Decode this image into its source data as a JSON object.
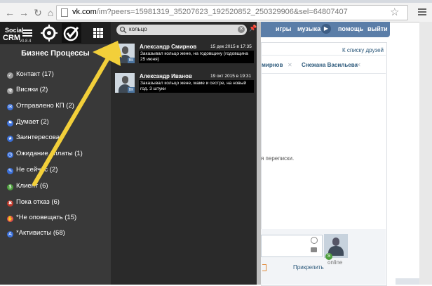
{
  "browser": {
    "url_host": "vk.com",
    "url_rest": "/im?peers=15981319_35207623_192520852_250329906&sel=64807407"
  },
  "vk": {
    "nav": [
      "игры",
      "музыка",
      "помощь",
      "выйти"
    ],
    "to_friends": "К списку друзей",
    "friends": [
      "мирнов",
      "Снежана Васильева"
    ],
    "history_text": "я переписки.",
    "attach": "Прикрепить",
    "online": "online",
    "s_badge": "S"
  },
  "sidebar": {
    "logo_line1": "Social",
    "logo_line2": "CRM",
    "version": "v0.8.4",
    "heading": "Бизнес Процессы",
    "items": [
      {
        "label": "Контакт (17)",
        "color": "#9a9a9a",
        "glyph": "✓"
      },
      {
        "label": "Висяки (2)",
        "color": "#9a9a9a",
        "glyph": "✻"
      },
      {
        "label": "Отправлено КП (2)",
        "color": "#3a6fd8",
        "glyph": "✉"
      },
      {
        "label": "Думает (2)",
        "color": "#3a6fd8",
        "glyph": "⚑"
      },
      {
        "label": "Заинтересован",
        "color": "#3a6fd8",
        "glyph": "★"
      },
      {
        "label": "Ожидание оплаты (1)",
        "color": "#3a6fd8",
        "glyph": "◷"
      },
      {
        "label": "Не сейчас (2)",
        "color": "#3a6fd8",
        "glyph": "✎"
      },
      {
        "label": "Клиент (6)",
        "color": "#4e9f3d",
        "glyph": "$"
      },
      {
        "label": "Пока отказ (6)",
        "color": "#c0392b",
        "glyph": "✖"
      },
      {
        "label": "*Не оповещать (15)",
        "color": "#e05050",
        "glyph": "✋"
      },
      {
        "label": "*Активисты (68)",
        "color": "#3a6fd8",
        "glyph": "A"
      }
    ]
  },
  "search": {
    "query": "кольцо",
    "results": [
      {
        "name": "Александр Смирнов",
        "date": "15 дек 2015 в 17:35",
        "text": "Заказывал кольцо жене, на годовщину (годовщина 25 июня)",
        "vk": "ВК"
      },
      {
        "name": "Александр Иванов",
        "date": "19 окт 2015 в 19:31",
        "text": "Заказывал кольцо жене, маме и сестре, на новый год. 3 штуки",
        "vk": "ВК"
      }
    ]
  }
}
